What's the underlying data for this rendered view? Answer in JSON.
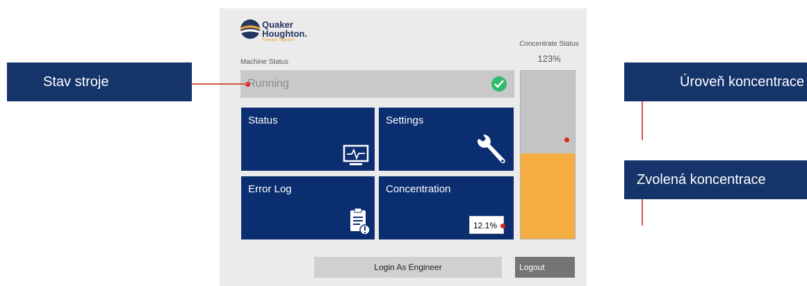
{
  "brand": {
    "name_line1": "Quaker",
    "name_line2": "Houghton.",
    "tagline": "Forward Together",
    "icon": "quaker-houghton-logo"
  },
  "machine_status": {
    "label": "Machine Status",
    "value": "Running",
    "icon": "check-circle-icon"
  },
  "tiles": {
    "status": {
      "label": "Status",
      "icon": "monitor-pulse-icon"
    },
    "settings": {
      "label": "Settings",
      "icon": "wrench-icon"
    },
    "error_log": {
      "label": "Error Log",
      "icon": "clipboard-alert-icon"
    },
    "concentration": {
      "label": "Concentration",
      "value": "12.1%"
    }
  },
  "concentrate_status": {
    "label": "Concentrate Status",
    "value": "123%",
    "fill_fraction": 0.51
  },
  "buttons": {
    "login": "Login As Engineer",
    "logout": "Logout"
  },
  "callouts": {
    "machine_state": "Stav stroje",
    "concentration_level": "Úroveň koncentrace",
    "selected_concentration": "Zvolená koncentrace"
  },
  "colors": {
    "tile": "#0b2e70",
    "callout": "#14346a",
    "gauge_fill": "#f5ad42",
    "marker": "#e2231a",
    "status_ok": "#2ebd6b"
  }
}
